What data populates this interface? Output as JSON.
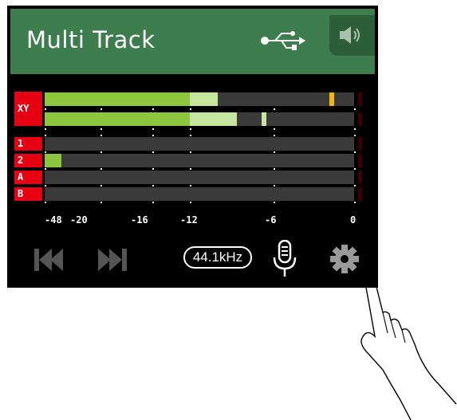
{
  "header": {
    "title": "Multi Track",
    "usb_icon": "usb-icon",
    "speaker_icon": "speaker-icon"
  },
  "channels": [
    {
      "label": "XY",
      "rows": 2
    },
    {
      "label": "1",
      "rows": 1
    },
    {
      "label": "2",
      "rows": 1
    },
    {
      "label": "A",
      "rows": 1
    },
    {
      "label": "B",
      "rows": 1
    }
  ],
  "meters": [
    {
      "channel": "XY",
      "level": 0.47,
      "hold": 0.56,
      "peak": 0.92,
      "peak_color": "#f2b705"
    },
    {
      "channel": "XY",
      "level": 0.47,
      "hold": 0.62,
      "peak": 0.7,
      "peak_color": "#c6e6a0"
    },
    {
      "channel": "1",
      "level": 0.0,
      "hold": 0.0
    },
    {
      "channel": "2",
      "level": 0.055,
      "hold": 0.0
    },
    {
      "channel": "A",
      "level": 0.0,
      "hold": 0.0
    },
    {
      "channel": "B",
      "level": 0.0,
      "hold": 0.0
    }
  ],
  "scale_labels": [
    "-48",
    "-20",
    "-16",
    "-12",
    "-6",
    "0"
  ],
  "controls": {
    "rewind_icon": "skip-back-icon",
    "forward_icon": "skip-forward-icon",
    "sample_rate": "44.1kHz",
    "mic_icon": "microphone-icon",
    "settings_icon": "gear-icon"
  },
  "colors": {
    "header_bg": "#3e7d4d",
    "meter_fill": "#8cc63f",
    "meter_hold": "#c6e6a0",
    "channel_label_bg": "#e60012",
    "peak_yellow": "#f2b705"
  }
}
